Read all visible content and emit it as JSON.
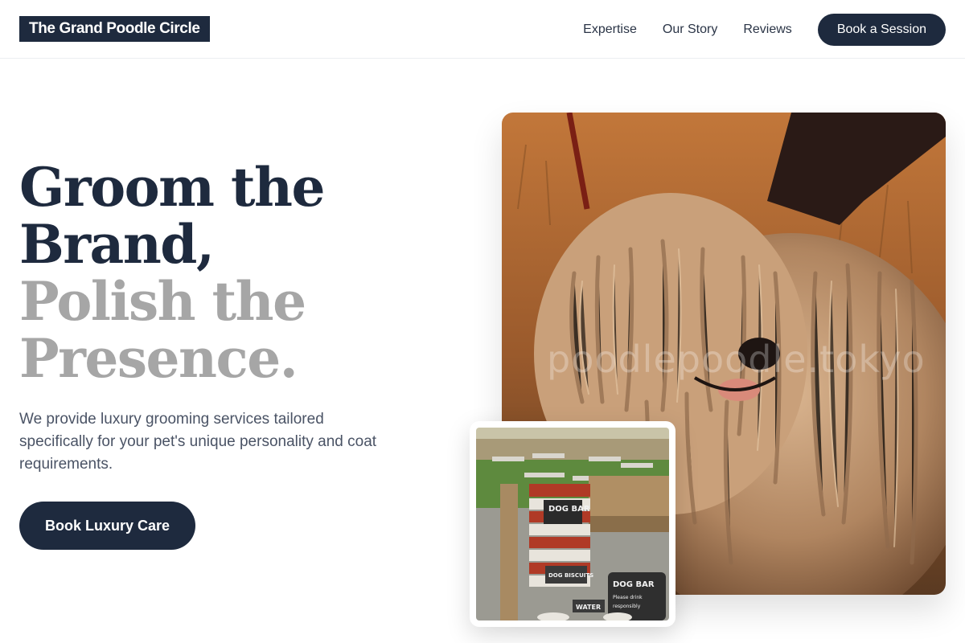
{
  "header": {
    "logo": "The Grand Poodle Circle",
    "nav": [
      "Expertise",
      "Our Story",
      "Reviews"
    ],
    "cta": "Book a Session"
  },
  "hero": {
    "title_dark_1": "Groom the",
    "title_dark_2": "Brand,",
    "title_muted_1": "Polish the",
    "title_muted_2": "Presence.",
    "subtitle": "We provide luxury grooming services tailored specifically for your pet's unique personality and coat requirements.",
    "cta": "Book Luxury Care"
  },
  "main_image": {
    "subject": "corded-dog-photo",
    "watermark": "poodlepoodle.tokyo"
  },
  "inset_image": {
    "subject": "dog-bar-photo",
    "sign_1": "DOG BAR",
    "sign_2": "DOG BISCUITS",
    "sign_3": "DOG BAR",
    "sign_4": "Please drink responsibly",
    "sign_5": "WATER"
  },
  "colors": {
    "navy": "#1e2a3e",
    "muted_title": "#a6a6a6",
    "body_text": "#4a5365",
    "background": "#ffffff"
  }
}
